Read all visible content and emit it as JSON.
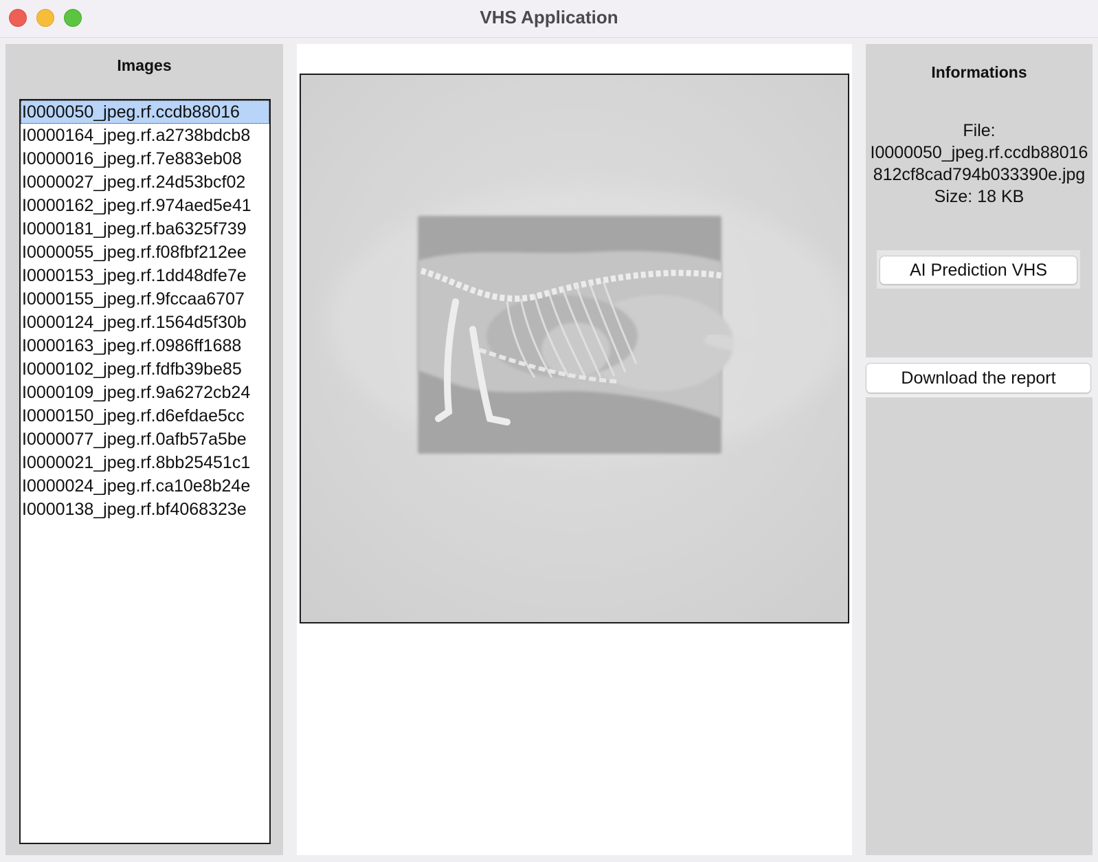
{
  "window": {
    "title": "VHS Application"
  },
  "images_panel": {
    "heading": "Images",
    "items": [
      "I0000050_jpeg.rf.ccdb88016",
      "I0000164_jpeg.rf.a2738bdcb8",
      "I0000016_jpeg.rf.7e883eb08",
      "I0000027_jpeg.rf.24d53bcf02",
      "I0000162_jpeg.rf.974aed5e41",
      "I0000181_jpeg.rf.ba6325f739",
      "I0000055_jpeg.rf.f08fbf212ee",
      "I0000153_jpeg.rf.1dd48dfe7e",
      "I0000155_jpeg.rf.9fccaa6707",
      "I0000124_jpeg.rf.1564d5f30b",
      "I0000163_jpeg.rf.0986ff1688",
      "I0000102_jpeg.rf.fdfb39be85",
      "I0000109_jpeg.rf.9a6272cb24",
      "I0000150_jpeg.rf.d6efdae5cc",
      "I0000077_jpeg.rf.0afb57a5be",
      "I0000021_jpeg.rf.8bb25451c1",
      "I0000024_jpeg.rf.ca10e8b24e",
      "I0000138_jpeg.rf.bf4068323e"
    ],
    "selected_index": 0
  },
  "info_panel": {
    "heading": "Informations",
    "file_label": "File:",
    "file_name_line1": "I0000050_jpeg.rf.ccdb88016",
    "file_name_line2": "812cf8cad794b033390e.jpg",
    "size_text": "Size: 18 KB",
    "predict_button": "AI Prediction VHS",
    "download_button": "Download the report"
  },
  "colors": {
    "selection": "#b8d4f8",
    "panel": "#d4d4d4"
  }
}
